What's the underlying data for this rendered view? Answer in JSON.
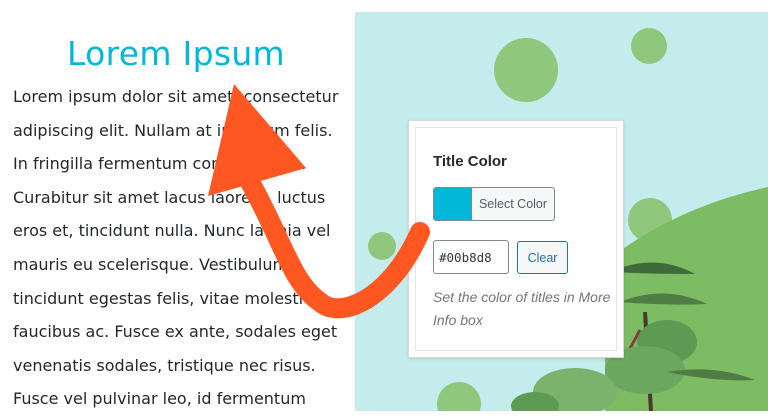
{
  "heading": {
    "title": "Lorem Ipsum",
    "title_color": "#00b8d8"
  },
  "body_lines": [
    "Lorem ipsum dolor sit amet, consectetur",
    "adipiscing elit. Nullam at interdum felis.",
    "In fringilla fermentum convallis odio.",
    "Curabitur sit amet lacus laoreet, luctus",
    "eros et, tincidunt nulla. Nunc lacinia vel",
    "mauris eu scelerisque. Vestibulum",
    "tincidunt egestas felis, vitae molestie",
    "faucibus ac. Fusce ex ante, sodales eget",
    "venenatis sodales, tristique nec risus.",
    "Fusce vel pulvinar leo, id fermentum"
  ],
  "settings_popup": {
    "title": "Title Color",
    "select_color_label": "Select Color",
    "swatch_color": "#00b8d8",
    "hex_value": "#00b8d8",
    "clear_label": "Clear",
    "help_text": "Set the color of titles in More Info box"
  },
  "colors": {
    "accent": "#00b8d8",
    "arrow": "#ff5722",
    "scene_background": "#c5ecec",
    "bubble": "#8fc87d",
    "hill": "#7cbc62"
  },
  "icons": [
    "arrow-annotation-icon",
    "color-swatch-icon"
  ]
}
